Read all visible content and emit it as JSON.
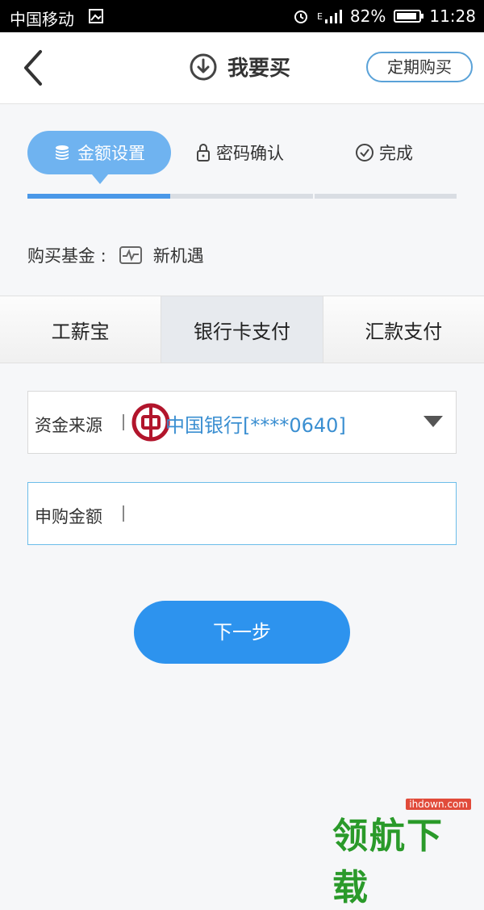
{
  "status_bar": {
    "carrier": "中国移动",
    "network": "E",
    "battery": "82%",
    "time": "11:28"
  },
  "header": {
    "title": "我要买",
    "right_button": "定期购买",
    "back_icon": "chevron-left-icon",
    "title_icon": "download-circle-icon"
  },
  "steps": {
    "items": [
      {
        "label": "金额设置",
        "icon": "coins-icon",
        "active": true
      },
      {
        "label": "密码确认",
        "icon": "lock-icon",
        "active": false
      },
      {
        "label": "完成",
        "icon": "check-circle-icon",
        "active": false
      }
    ],
    "progress": 0.333
  },
  "fund": {
    "label": "购买基金 :",
    "name": "新机遇"
  },
  "pay_tabs": {
    "items": [
      "工薪宝",
      "银行卡支付",
      "汇款支付"
    ],
    "selected": "银行卡支付"
  },
  "form": {
    "source_label": "资金来源",
    "source_value": "中国银行[****0640]",
    "amount_label": "申购金额",
    "amount_value": ""
  },
  "next_button": "下一步",
  "watermark": {
    "text": "领航下载",
    "sub": "ihdown.com"
  },
  "colors": {
    "accent": "#2d93ee",
    "step_active": "#6fb3f0",
    "bank_text": "#3b8fd1",
    "bank_logo": "#b2152c",
    "watermark": "#2a9a2a"
  }
}
